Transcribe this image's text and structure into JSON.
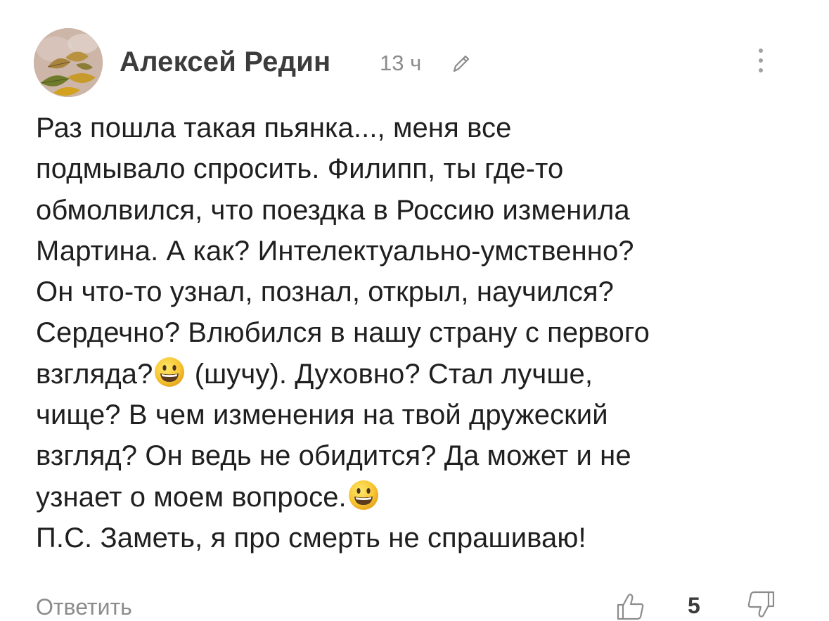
{
  "comment": {
    "author": "Алексей Редин",
    "time": "13 ч",
    "icons": {
      "avatar": "user-avatar-autumn-leaves",
      "edit": "pencil-icon",
      "menu": "vertical-dots-icon",
      "like": "thumbs-up-icon",
      "dislike": "thumbs-down-icon",
      "emoji": "grinning-face-emoji"
    },
    "lines": [
      "Раз пошла такая пьянка..., меня все",
      "подмывало спросить. Филипп, ты где-то",
      "обмолвился, что поездка в Россию изменила",
      "Мартина. А как? Интелектуально-умственно?",
      "Он что-то узнал, познал, открыл, научился?",
      "Сердечно? Влюбился в нашу страну с первого",
      "взгляда?",
      " (шучу). Духовно? Стал лучше,",
      "чище? В чем изменения на твой дружеский",
      "взгляд? Он ведь не обидится? Да может и не",
      "узнает о моем вопросе.",
      "П.С. Заметь, я про смерть не спрашиваю!"
    ],
    "reply_label": "Ответить",
    "likes": "5"
  }
}
